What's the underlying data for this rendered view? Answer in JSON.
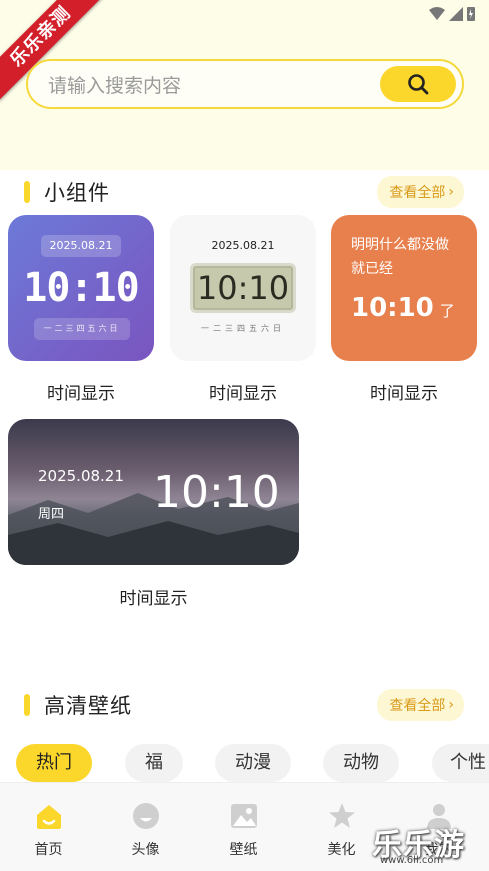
{
  "ribbon": {
    "text": "乐乐亲测"
  },
  "search": {
    "placeholder": "请输入搜索内容",
    "icon": "search-icon"
  },
  "widgets_section": {
    "title": "小组件",
    "view_all": "查看全部",
    "items": [
      {
        "style": "purple-digital",
        "date": "2025.08.21",
        "time": "10:10",
        "week": "一二三四五六日",
        "label": "时间显示"
      },
      {
        "style": "lcd",
        "date": "2025.08.21",
        "time": "10:10",
        "week": "一二三四五六日",
        "label": "时间显示"
      },
      {
        "style": "orange-text",
        "text": "明明什么都没做就已经",
        "time": "10:10",
        "suffix": "了",
        "label": "时间显示"
      },
      {
        "style": "mountain",
        "date": "2025.08.21",
        "day": "周四",
        "time": "10:10",
        "label": "时间显示"
      }
    ]
  },
  "wallpaper_section": {
    "title": "高清壁纸",
    "view_all": "查看全部",
    "tabs": [
      {
        "label": "热门",
        "active": true
      },
      {
        "label": "福",
        "active": false
      },
      {
        "label": "动漫",
        "active": false
      },
      {
        "label": "动物",
        "active": false
      },
      {
        "label": "个性",
        "active": false
      }
    ]
  },
  "bottom_nav": [
    {
      "label": "首页",
      "icon": "home-icon",
      "active": true
    },
    {
      "label": "头像",
      "icon": "avatar-icon",
      "active": false
    },
    {
      "label": "壁纸",
      "icon": "image-icon",
      "active": false
    },
    {
      "label": "美化",
      "icon": "star-icon",
      "active": false
    },
    {
      "label": "我的",
      "icon": "user-icon",
      "active": false
    }
  ],
  "watermark": {
    "text": "乐乐游戏",
    "url": "www.6ll.com"
  },
  "colors": {
    "accent": "#fcd72b",
    "top_bg": "#fefde8",
    "orange_widget": "#e8804e",
    "purple_widget": "#7563c9"
  }
}
